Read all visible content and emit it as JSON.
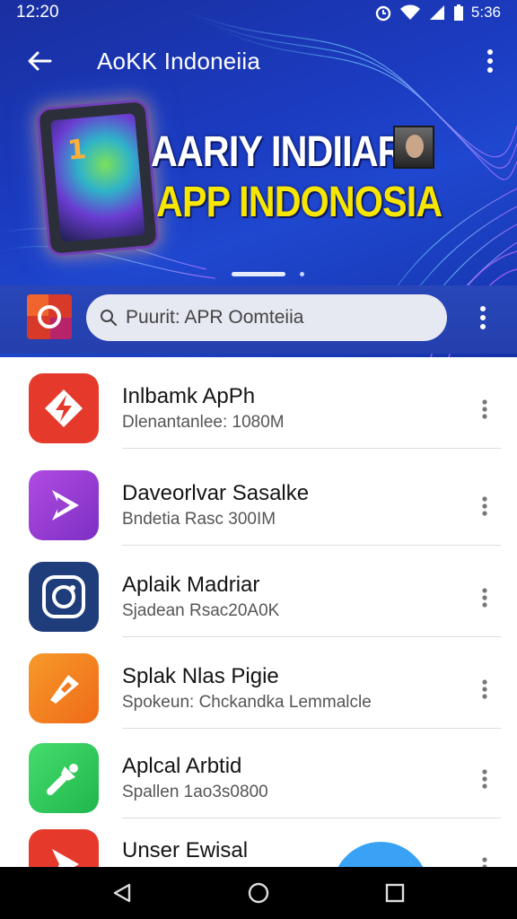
{
  "status_bar": {
    "time": "12:20",
    "battery_text": "5:36",
    "icons": [
      "alarm-icon",
      "wifi-icon",
      "signal-icon",
      "battery-icon"
    ]
  },
  "app_bar": {
    "title": "AoKK Indoneiia",
    "back_icon": "arrow-left-icon",
    "overflow_icon": "more-vert-icon"
  },
  "banner": {
    "line1": "AARIY INDIIAR",
    "line2": "APP INDONOSIA",
    "tablet_number": "1"
  },
  "search": {
    "text": "Puurit: APR Oomteiia",
    "icon": "search-icon"
  },
  "list": [
    {
      "title": "Inlbamk ApPh",
      "subtitle": "Dlenantanlee: 1080M",
      "color": "#e53a2b",
      "icon": "diamond-arrows-icon"
    },
    {
      "title": "Daveorlvar Sasalke",
      "subtitle": "Bndetia Rasc 300IM",
      "color": "#9b3fd1",
      "icon": "play-arrow-icon"
    },
    {
      "title": "Aplaik Madriar",
      "subtitle": "Sjadean Rsac20A0K",
      "color": "#1f3d7a",
      "icon": "camera-ring-icon"
    },
    {
      "title": "Splak Nlas Pigie",
      "subtitle": "Spokeun: Chckandka Lemmalcle",
      "color": "#f37a1e",
      "icon": "pencil-shape-icon"
    },
    {
      "title": "Aplcal Arbtid",
      "subtitle": "Spallen 1ao3s0800",
      "color": "#2ec95a",
      "icon": "wrench-icon"
    },
    {
      "title": "Unser Ewisal",
      "subtitle": "",
      "color": "#e53a2b",
      "icon": "play-arrow-icon"
    }
  ],
  "nav": {
    "back_icon": "nav-back-triangle-icon",
    "home_icon": "nav-home-circle-icon",
    "recents_icon": "nav-recents-square-icon"
  },
  "colors": {
    "hero_blue": "#1b3bc0",
    "banner_yellow": "#f7e600",
    "fab_blue": "#3aa2f5"
  }
}
